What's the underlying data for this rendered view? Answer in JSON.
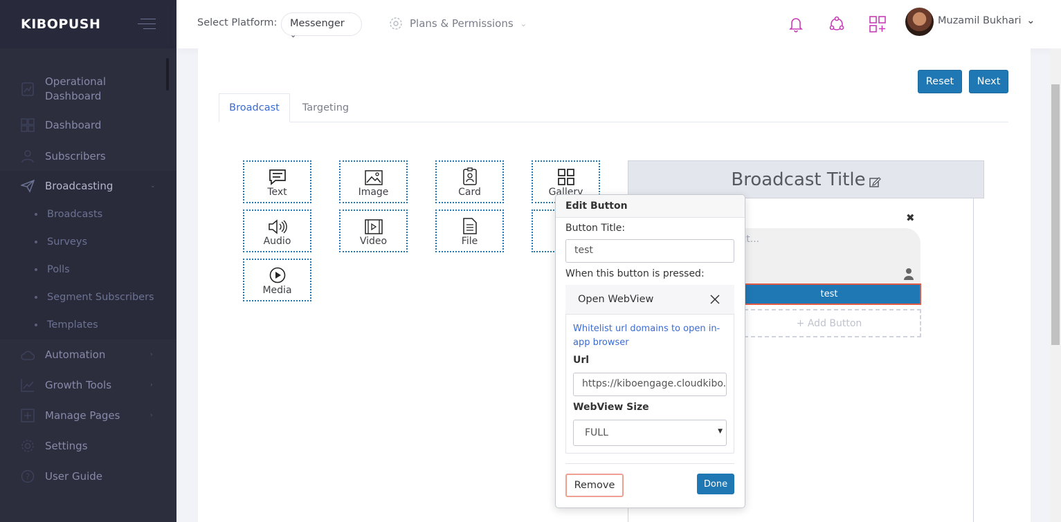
{
  "sidebar": {
    "brand": "KIBOPUSH",
    "items": [
      {
        "label_l1": "Operational",
        "label_l2": "Dashboard",
        "icon": "chart-icon"
      },
      {
        "label": "Dashboard",
        "icon": "dashboard-grid-icon"
      },
      {
        "label": "Subscribers",
        "icon": "user-icon"
      },
      {
        "label": "Broadcasting",
        "icon": "paper-plane-icon"
      },
      {
        "label": "Automation",
        "icon": "cloud-icon"
      },
      {
        "label": "Growth Tools",
        "icon": "line-chart-icon"
      },
      {
        "label": "Manage Pages",
        "icon": "add-page-icon"
      },
      {
        "label": "Settings",
        "icon": "gear-icon"
      },
      {
        "label": "User Guide",
        "icon": "question-icon"
      }
    ],
    "broadcasting_sub": [
      "Broadcasts",
      "Surveys",
      "Polls",
      "Segment Subscribers",
      "Templates"
    ]
  },
  "topbar": {
    "select_platform_label": "Select Platform:",
    "platform_value": "Messenger",
    "plans_label": "Plans & Permissions",
    "user_name": "Muzamil Bukhari",
    "accent_color": "#c83cb8"
  },
  "actions": {
    "reset": "Reset",
    "next": "Next"
  },
  "tabs": [
    "Broadcast",
    "Targeting"
  ],
  "components": [
    {
      "label": "Text",
      "icon": "chat-icon"
    },
    {
      "label": "Image",
      "icon": "image-icon"
    },
    {
      "label": "Card",
      "icon": "card-icon"
    },
    {
      "label": "Gallery",
      "icon": "gallery-icon"
    },
    {
      "label": "Audio",
      "icon": "speaker-icon"
    },
    {
      "label": "Video",
      "icon": "video-icon"
    },
    {
      "label": "File",
      "icon": "file-icon"
    },
    {
      "label": "Media",
      "icon": "play-circle-icon"
    }
  ],
  "preview": {
    "title": "Broadcast Title",
    "text_placeholder": "xt...",
    "button_label": "test",
    "add_button": "+ Add Button"
  },
  "edit_button": {
    "header": "Edit Button",
    "title_label": "Button Title:",
    "title_value": "test",
    "pressed_label": "When this button is pressed:",
    "action": "Open WebView",
    "whitelist_link": "Whitelist url domains to open in-app browser",
    "url_label": "Url",
    "url_value": "https://kiboengage.cloudkibo.co",
    "size_label": "WebView Size",
    "size_value": "FULL",
    "remove": "Remove",
    "done": "Done"
  }
}
